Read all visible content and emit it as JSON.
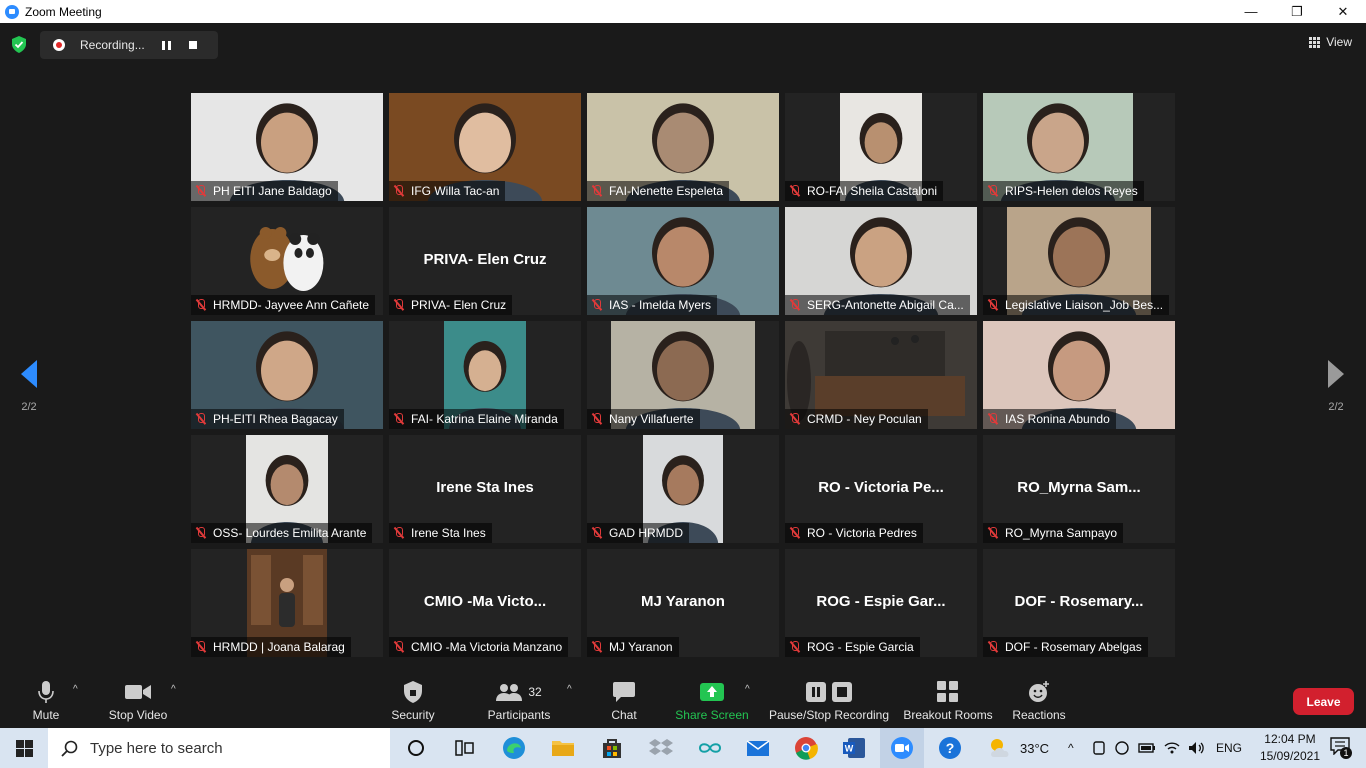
{
  "window": {
    "title": "Zoom Meeting",
    "controls": [
      "—",
      "❐",
      "✕"
    ]
  },
  "recording": {
    "status": "Recording..."
  },
  "view_label": "View",
  "pagination": {
    "left": "2/2",
    "right": "2/2"
  },
  "participants": [
    {
      "label": "PH EITI   Jane Baldago",
      "center": "",
      "video": "face",
      "bg": "#e6e6e6",
      "skin": "#c9a080",
      "vx": 0,
      "vw": 192
    },
    {
      "label": "IFG Willa Tac-an",
      "center": "",
      "video": "face",
      "bg": "#7a4a22",
      "skin": "#e0bda0",
      "vx": 0,
      "vw": 192
    },
    {
      "label": "FAI-Nenette Espeleta",
      "center": "",
      "video": "face",
      "bg": "#c9c2a8",
      "skin": "#a98b73",
      "vx": 0,
      "vw": 192
    },
    {
      "label": "RO-FAI Sheila Castaloni",
      "center": "",
      "video": "face",
      "bg": "#e8e6e2",
      "skin": "#b89070",
      "vx": 55,
      "vw": 82
    },
    {
      "label": "RIPS-Helen delos Reyes",
      "center": "",
      "video": "face",
      "bg": "#b7c9b9",
      "skin": "#c9a58a",
      "vx": 0,
      "vw": 150
    },
    {
      "label": "HRMDD- Jayvee Ann Cañete",
      "center": "",
      "video": "bears",
      "bg": "#232323",
      "skin": "#8b5a2b",
      "vx": 55,
      "vw": 82
    },
    {
      "label": "PRIVA- Elen Cruz",
      "center": "PRIVA- Elen Cruz",
      "video": "none",
      "bg": "#232323",
      "skin": "",
      "vx": 0,
      "vw": 0
    },
    {
      "label": "IAS - Imelda Myers",
      "center": "",
      "video": "face",
      "bg": "#6e8a92",
      "skin": "#b8886a",
      "vx": 0,
      "vw": 192
    },
    {
      "label": "SERG-Antonette Abigail Ca...",
      "center": "",
      "video": "face",
      "bg": "#d6d6d4",
      "skin": "#caa282",
      "vx": 0,
      "vw": 192
    },
    {
      "label": "Legislative Liaison_Job Bes...",
      "center": "",
      "video": "face",
      "bg": "#b9a48a",
      "skin": "#9c7458",
      "vx": 24,
      "vw": 144
    },
    {
      "label": "PH-EITI Rhea Bagacay",
      "center": "",
      "video": "face",
      "bg": "#3f5560",
      "skin": "#cfa788",
      "vx": 0,
      "vw": 192
    },
    {
      "label": "FAI- Katrina Elaine Miranda",
      "center": "",
      "video": "face",
      "bg": "#3c8c8a",
      "skin": "#d5b091",
      "vx": 55,
      "vw": 82
    },
    {
      "label": "Nany Villafuerte",
      "center": "",
      "video": "face",
      "bg": "#b6b2a4",
      "skin": "#8c6a52",
      "vx": 24,
      "vw": 144
    },
    {
      "label": "CRMD - Ney Poculan",
      "center": "",
      "video": "room",
      "bg": "#3e3a36",
      "skin": "#5a4a3e",
      "vx": 0,
      "vw": 192
    },
    {
      "label": "IAS Ronina Abundo",
      "center": "",
      "video": "face",
      "bg": "#dcc6bc",
      "skin": "#c69a80",
      "vx": 0,
      "vw": 192
    },
    {
      "label": "OSS- Lourdes Emilita Arante",
      "center": "",
      "video": "face",
      "bg": "#e4e4e2",
      "skin": "#b48a6e",
      "vx": 55,
      "vw": 82
    },
    {
      "label": "Irene Sta Ines",
      "center": "Irene Sta Ines",
      "video": "none",
      "bg": "#232323",
      "skin": "",
      "vx": 0,
      "vw": 0
    },
    {
      "label": "GAD HRMDD",
      "center": "",
      "video": "face-small",
      "bg": "#d8dadc",
      "skin": "#a67a5e",
      "vx": 56,
      "vw": 80
    },
    {
      "label": "RO - Victoria Pedres",
      "center": "RO  - Victoria Pe...",
      "video": "none",
      "bg": "#232323",
      "skin": "",
      "vx": 0,
      "vw": 0
    },
    {
      "label": "RO_Myrna Sampayo",
      "center": "RO_Myrna  Sam...",
      "video": "none",
      "bg": "#232323",
      "skin": "",
      "vx": 0,
      "vw": 0
    },
    {
      "label": "HRMDD | Joana Balarag",
      "center": "",
      "video": "shop",
      "bg": "#5a3a24",
      "skin": "#c9a080",
      "vx": 56,
      "vw": 80
    },
    {
      "label": "CMIO -Ma Victoria Manzano",
      "center": "CMIO  -Ma  Victo...",
      "video": "none",
      "bg": "#232323",
      "skin": "",
      "vx": 0,
      "vw": 0
    },
    {
      "label": "MJ Yaranon",
      "center": "MJ Yaranon",
      "video": "none",
      "bg": "#232323",
      "skin": "",
      "vx": 0,
      "vw": 0
    },
    {
      "label": "ROG - Espie Garcia",
      "center": "ROG  - Espie Gar...",
      "video": "none",
      "bg": "#232323",
      "skin": "",
      "vx": 0,
      "vw": 0
    },
    {
      "label": "DOF - Rosemary Abelgas",
      "center": "DOF  - Rosemary...",
      "video": "none",
      "bg": "#232323",
      "skin": "",
      "vx": 0,
      "vw": 0
    }
  ],
  "toolbar": {
    "mute": "Mute",
    "stop_video": "Stop Video",
    "security": "Security",
    "participants": "Participants",
    "participants_count": "32",
    "chat": "Chat",
    "share_screen": "Share Screen",
    "pause_stop_recording": "Pause/Stop Recording",
    "breakout_rooms": "Breakout Rooms",
    "reactions": "Reactions",
    "leave": "Leave"
  },
  "colors": {
    "accent_green": "#23c552",
    "leave_red": "#d2202e",
    "nav_blue": "#2d8cff",
    "muted_red": "#e03a3a"
  },
  "taskbar": {
    "search_placeholder": "Type here to search",
    "temperature": "33°C",
    "language": "ENG",
    "time": "12:04 PM",
    "date": "15/09/2021",
    "notification_count": "1"
  }
}
